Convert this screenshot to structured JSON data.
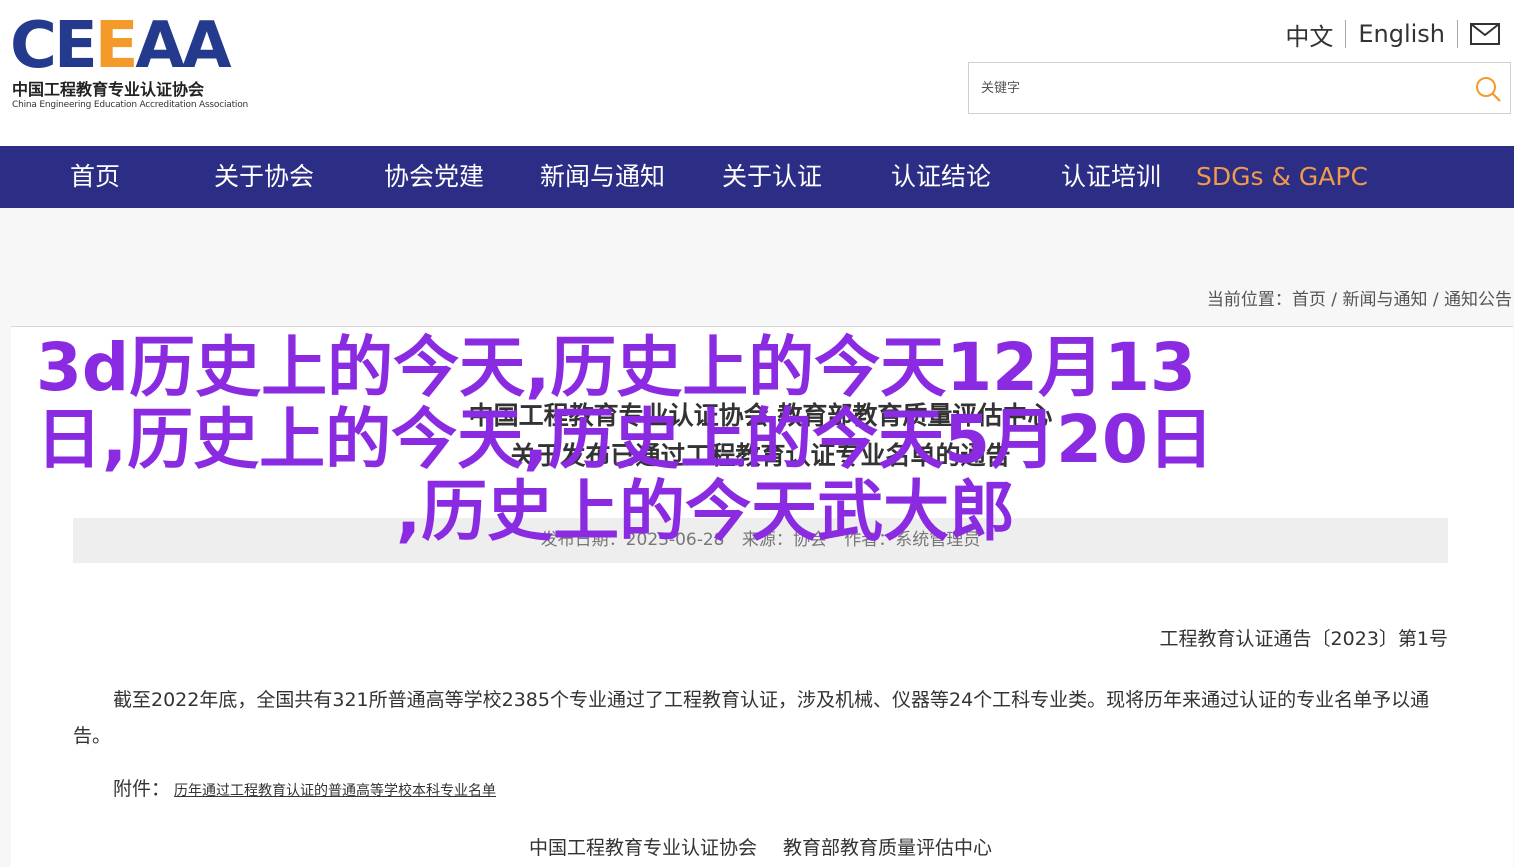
{
  "logo": {
    "mark_left": "CE",
    "mark_accent": "E",
    "mark_right": "AA",
    "cn": "中国工程教育专业认证协会",
    "en": "China Engineering Education Accreditation Association"
  },
  "lang_bar": {
    "zh": "中文",
    "en": "English",
    "mail_icon": "mail-icon"
  },
  "search": {
    "placeholder": "关键字",
    "icon": "search-icon"
  },
  "nav": {
    "items": [
      {
        "label": "首页"
      },
      {
        "label": "关于协会"
      },
      {
        "label": "协会党建"
      },
      {
        "label": "新闻与通知"
      },
      {
        "label": "关于认证"
      },
      {
        "label": "认证结论"
      },
      {
        "label": "认证培训"
      },
      {
        "label": "SDGs & GAPC"
      }
    ],
    "highlight_color": "#f39a4a",
    "bg_color": "#2c2d84"
  },
  "breadcrumb": {
    "prefix": "当前位置：",
    "items": [
      "首页",
      "新闻与通知",
      "通知公告"
    ],
    "separator": " / "
  },
  "article": {
    "title_line1": "中国工程教育专业认证协会 教育部教育质量评估中心",
    "title_line2": "关于发布已通过工程教育认证专业名单的通告",
    "meta": {
      "date": "发布日期：2023-06-28",
      "source": "来源：协会",
      "author": "作者：系统管理员"
    },
    "notice_no": "工程教育认证通告〔2023〕第1号",
    "body": "截至2022年底，全国共有321所普通高等学校2385个专业通过了工程教育认证，涉及机械、仪器等24个工科专业类。现将历年来通过认证的专业名单予以通告。",
    "attachment_label": "附件：",
    "attachment_link": "历年通过工程教育认证的普通高等学校本科专业名单",
    "signature_1": "中国工程教育专业认证协会",
    "signature_2": "教育部教育质量评估中心"
  },
  "overlay": {
    "line1": "3d历史上的今天,历史上的今天12月13",
    "line2": "日,历史上的今天,历史上的今天5月20日",
    "line3": ",历史上的今天武大郎",
    "color": "#8a2be2"
  }
}
